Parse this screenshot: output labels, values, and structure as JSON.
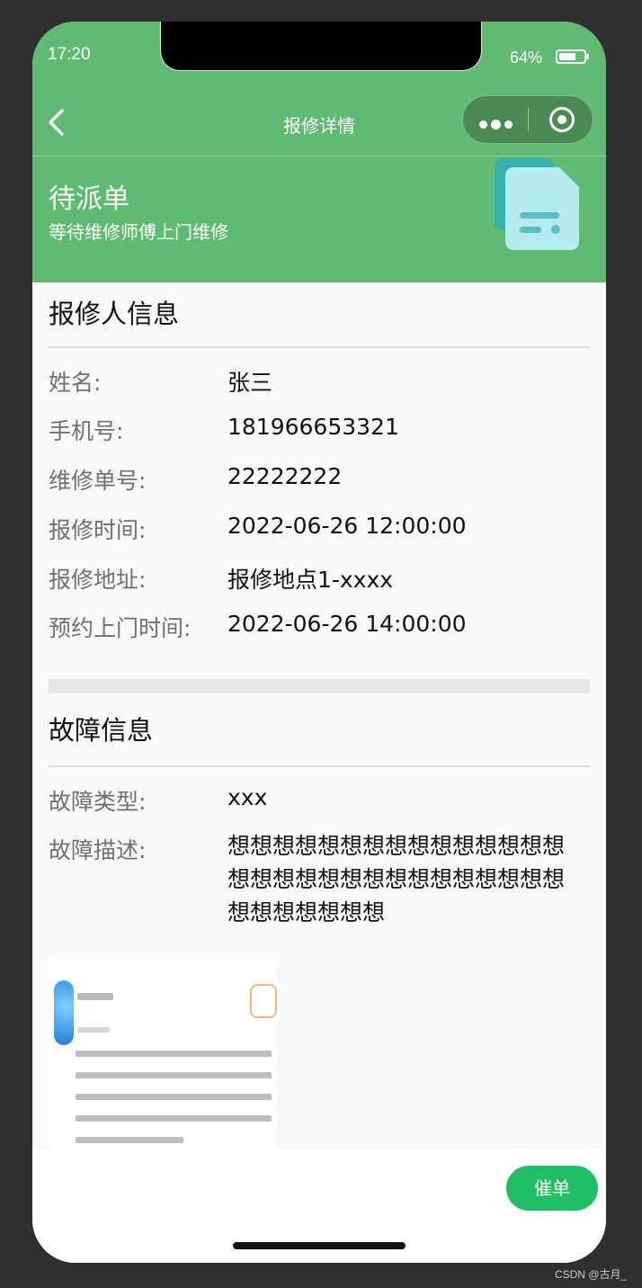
{
  "status_bar": {
    "time": "17:20",
    "battery_percent": "64%",
    "battery_level": 0.64
  },
  "nav": {
    "title": "报修详情",
    "back_icon": "chevron-left-icon",
    "capsule_more_icon": "more-dots-icon",
    "capsule_close_icon": "target-close-icon"
  },
  "banner": {
    "status": "待派单",
    "subtitle": "等待维修师傅上门维修",
    "icon": "document-icon",
    "color": "#60bb72"
  },
  "reporter": {
    "section_title": "报修人信息",
    "fields": [
      {
        "label": "姓名:",
        "value": "张三"
      },
      {
        "label": "手机号:",
        "value": "181966653321"
      },
      {
        "label": "维修单号:",
        "value": "22222222"
      },
      {
        "label": "报修时间:",
        "value": "2022-06-26 12:00:00"
      },
      {
        "label": "报修地址:",
        "value": "报修地点1-xxxx"
      },
      {
        "label": "预约上门时间:",
        "value": "2022-06-26 14:00:00"
      }
    ]
  },
  "fault": {
    "section_title": "故障信息",
    "type_label": "故障类型:",
    "type_value": "xxx",
    "desc_label": "故障描述:",
    "desc_value": "想想想想想想想想想想想想想想想想想想想想想想想想想想想想想想想想想想想想想"
  },
  "footer": {
    "urge_button": "催单",
    "button_color": "#1fbf64"
  },
  "watermark": "CSDN @古月_"
}
